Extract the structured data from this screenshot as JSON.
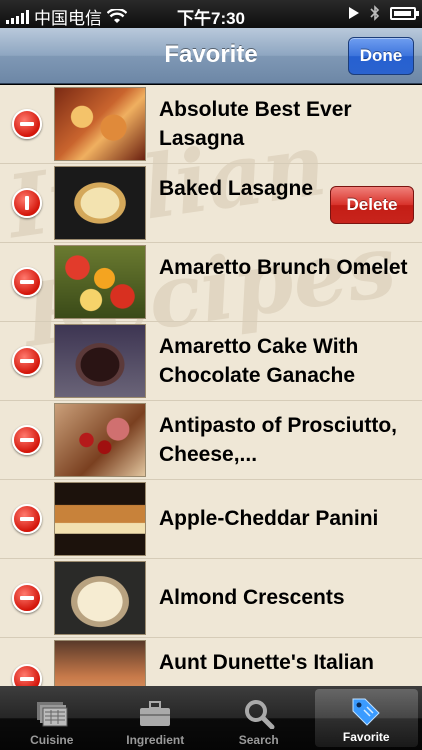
{
  "status_bar": {
    "carrier": "中国电信",
    "time": "下午7:30"
  },
  "nav": {
    "title": "Favorite",
    "done_label": "Done"
  },
  "watermark_text": "Italian Recipes",
  "recipes": [
    {
      "title": "Absolute Best Ever Lasagna"
    },
    {
      "title": "Baked Lasagne",
      "delete_label": "Delete"
    },
    {
      "title": "Amaretto Brunch Omelet"
    },
    {
      "title": "Amaretto Cake With Chocolate Ganache"
    },
    {
      "title": "Antipasto of Prosciutto, Cheese,..."
    },
    {
      "title": "Apple-Cheddar Panini"
    },
    {
      "title": "Almond Crescents"
    },
    {
      "title": "Aunt Dunette's Italian"
    }
  ],
  "tabs": [
    {
      "label": "Cuisine",
      "icon": "cuisine-icon"
    },
    {
      "label": "Ingredient",
      "icon": "briefcase-icon"
    },
    {
      "label": "Search",
      "icon": "search-icon"
    },
    {
      "label": "Favorite",
      "icon": "tag-icon",
      "active": true
    }
  ],
  "colors": {
    "delete_red": "#d3150a",
    "done_blue": "#2a63cf",
    "nav_bar": "#7f98b5",
    "list_background": "#efe7d6"
  }
}
